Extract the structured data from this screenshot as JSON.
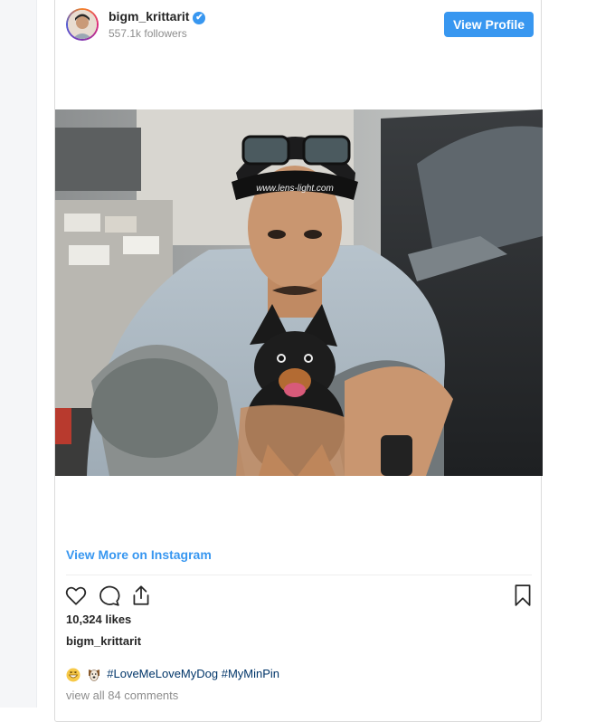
{
  "post": {
    "username": "bigm_krittarit",
    "verified_mark": "✔",
    "followers": "557.1k followers",
    "view_profile_label": "View Profile",
    "view_more_label": "View More on Instagram",
    "likes": "10,324 likes",
    "caption_user": "bigm_krittarit",
    "hashtags": [
      "#LoveMeLoveMyDog",
      "#MyMinPin"
    ],
    "comments_label": "view all 84 comments",
    "photo_cap_text": "www.lens-light.com"
  },
  "icons": {
    "like": "heart-icon",
    "comment": "comment-icon",
    "share": "share-icon",
    "save": "bookmark-icon",
    "verified": "verified-badge-icon"
  },
  "colors": {
    "accent": "#3897f0",
    "link": "#003569",
    "muted": "#8e8e8e",
    "text": "#262626"
  }
}
